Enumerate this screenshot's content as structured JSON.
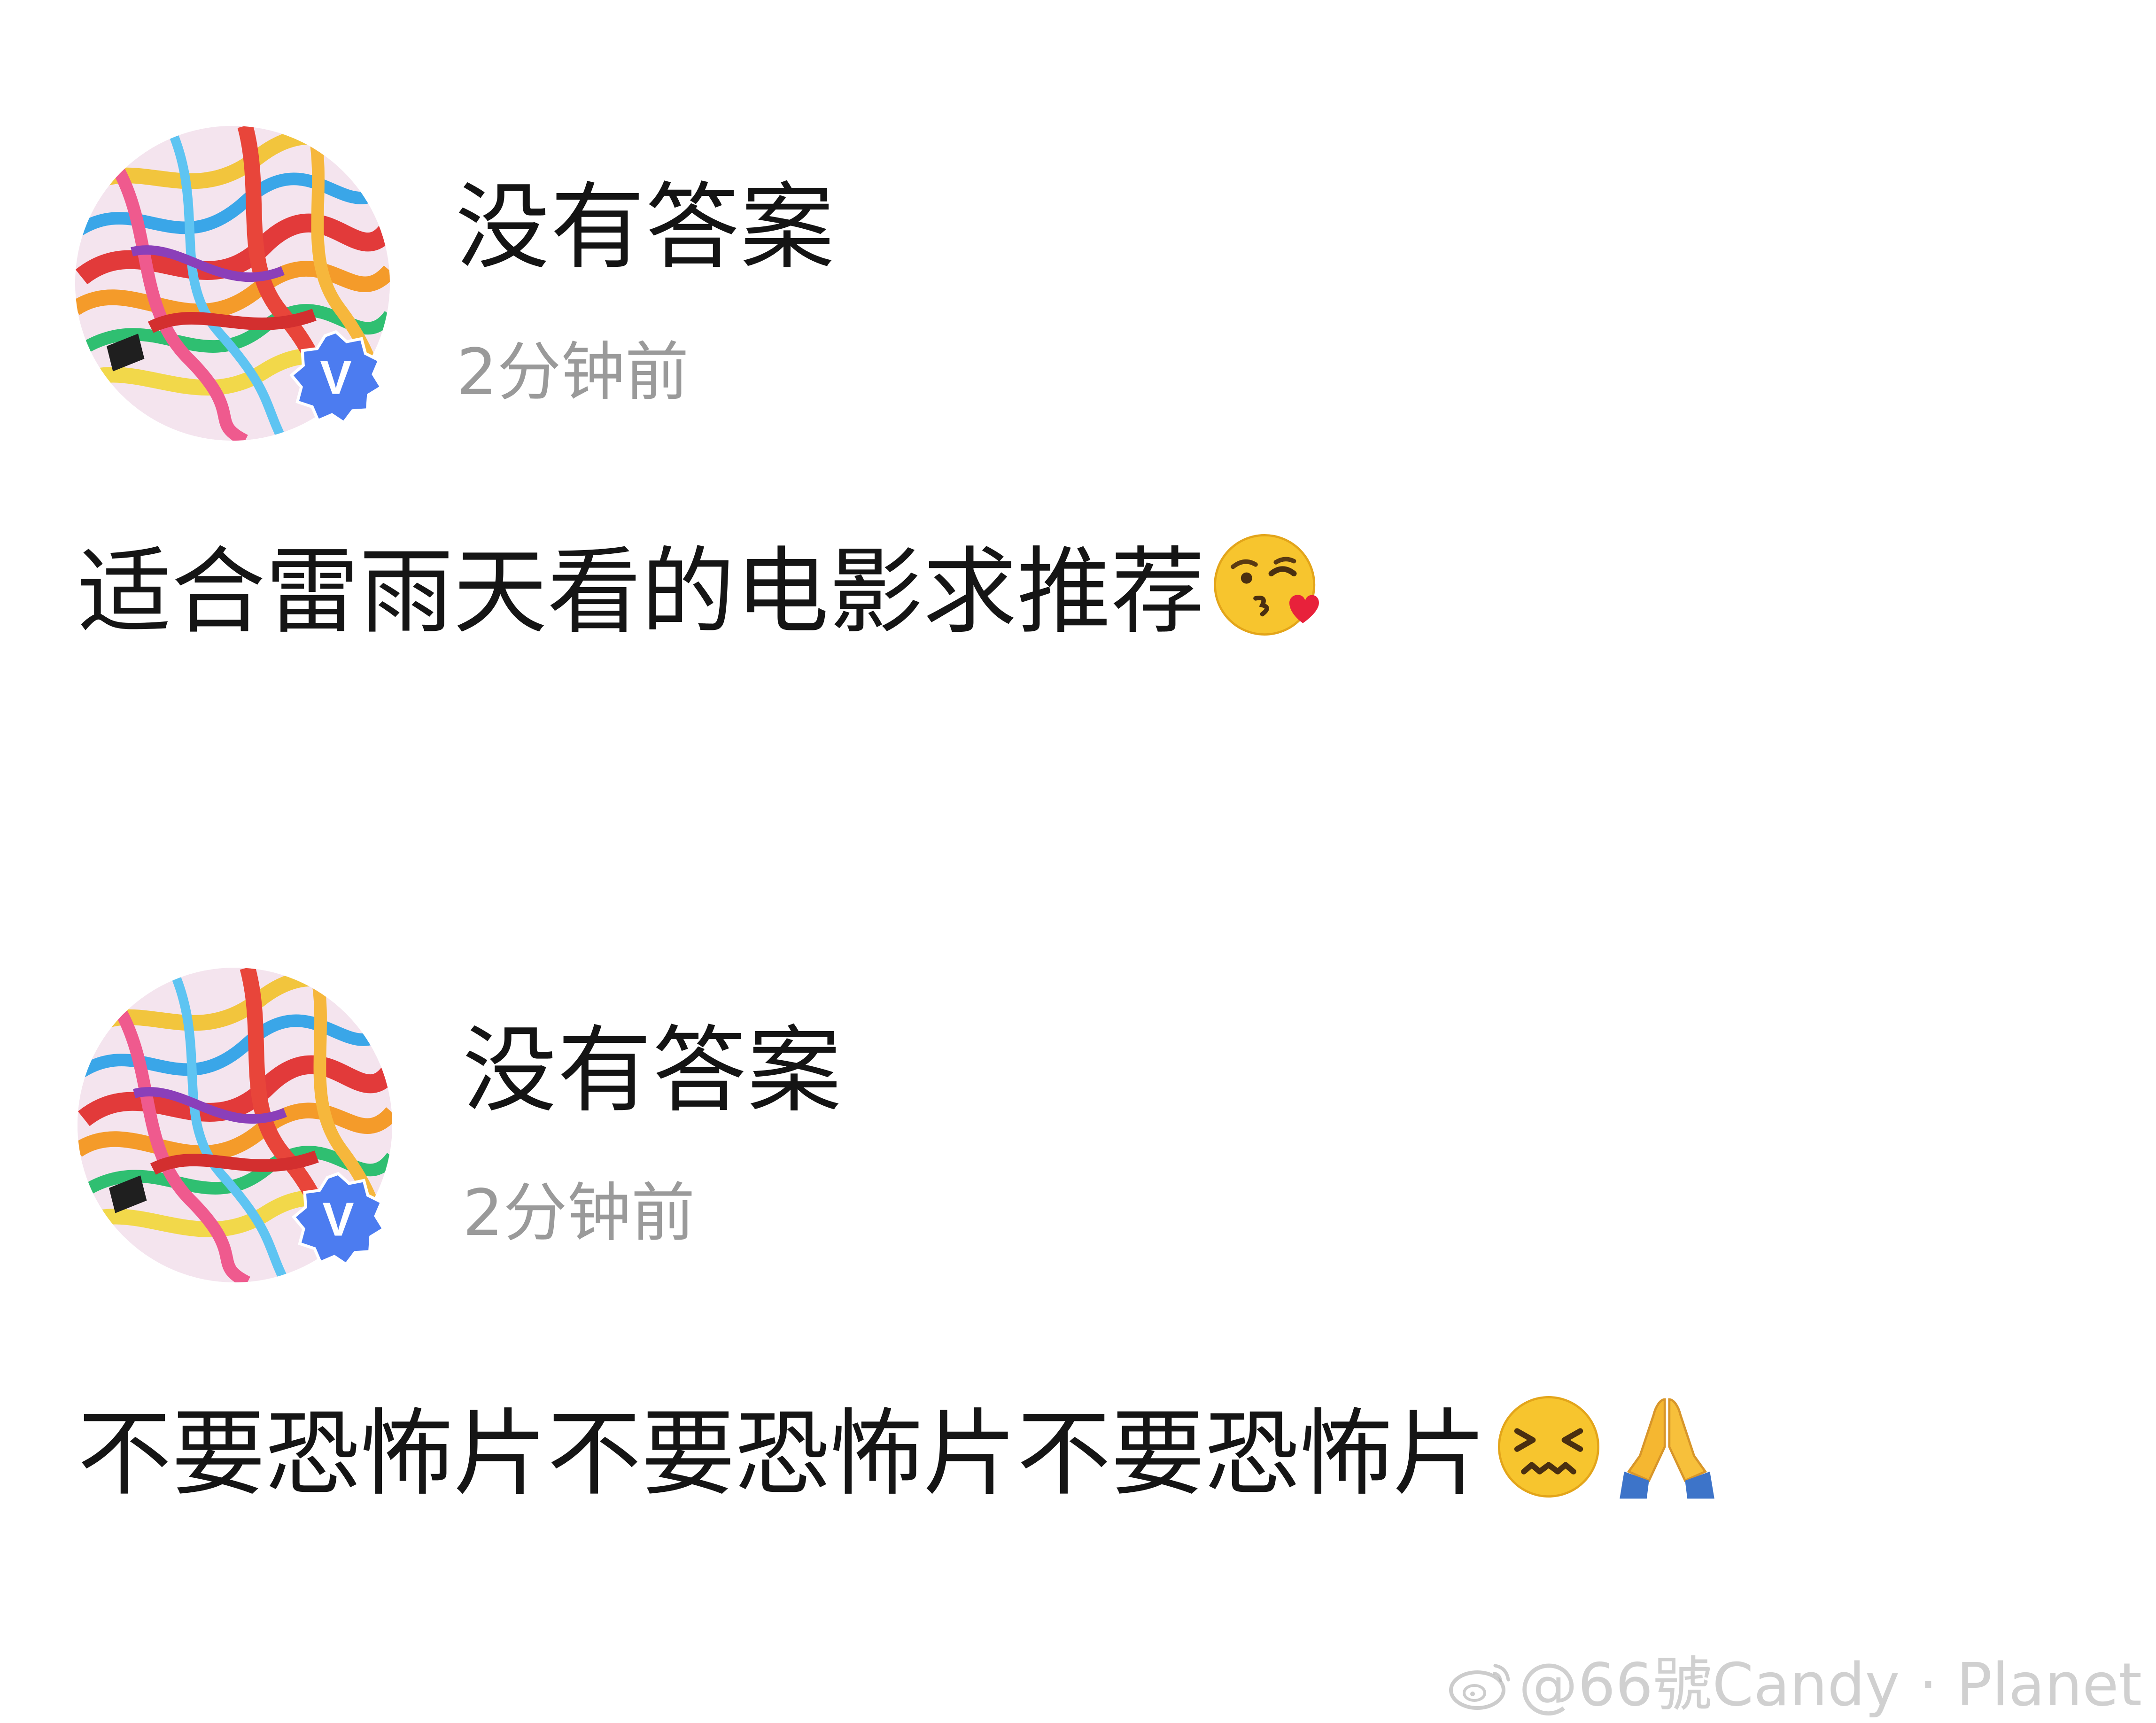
{
  "posts": [
    {
      "user": {
        "name": "没有答案",
        "avatar_icon": "colorful-ribbons-avatar",
        "badge_icon": "verified-v-badge",
        "badge_letter": "V"
      },
      "timestamp": "2分钟前",
      "text": "适合雷雨天看的电影求推荐",
      "emojis": [
        "face-blowing-kiss-emoji"
      ]
    },
    {
      "user": {
        "name": "没有答案",
        "avatar_icon": "colorful-ribbons-avatar",
        "badge_icon": "verified-v-badge",
        "badge_letter": "V"
      },
      "timestamp": "2分钟前",
      "text": "不要恐怖片不要恐怖片不要恐怖片",
      "emojis": [
        "confounded-face-emoji",
        "folded-hands-emoji"
      ]
    }
  ],
  "watermark": {
    "icon": "weibo-logo-icon",
    "text": "@66號Candy · Planet"
  },
  "colors": {
    "background": "#ffffff",
    "text": "#151515",
    "timestamp": "#9a9a9a",
    "verified_badge": "#4c7cf0",
    "watermark": "#aaaaaa"
  }
}
